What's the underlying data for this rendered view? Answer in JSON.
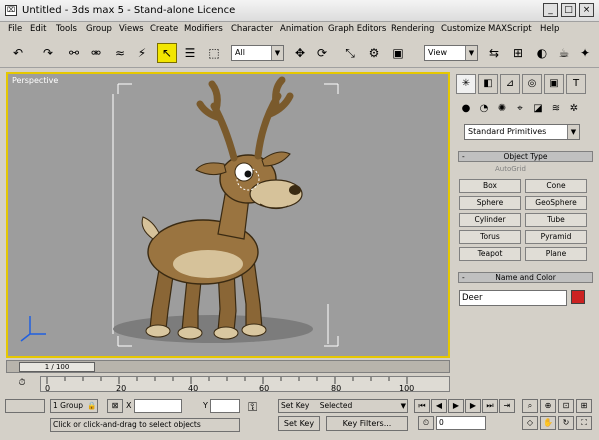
{
  "titlebar": {
    "app_icon": "3ds-max-icon",
    "title": "Untitled - 3ds max 5 - Stand-alone Licence"
  },
  "menu": [
    "File",
    "Edit",
    "Tools",
    "Group",
    "Views",
    "Create",
    "Modifiers",
    "Character",
    "Animation",
    "Graph Editors",
    "Rendering",
    "Customize",
    "MAXScript",
    "Help"
  ],
  "toolbar": {
    "selection_filter": "All",
    "ref_coord_system": "View"
  },
  "viewport": {
    "label": "Perspective"
  },
  "command_panel": {
    "category": "Standard Primitives",
    "object_type_title": "Object Type",
    "autogrid_label": "AutoGrid",
    "buttons": [
      "Box",
      "Cone",
      "Sphere",
      "GeoSphere",
      "Cylinder",
      "Tube",
      "Torus",
      "Pyramid",
      "Teapot",
      "Plane"
    ],
    "name_color_title": "Name and Color",
    "object_name": "Deer",
    "object_color": "#cc2222"
  },
  "timeline": {
    "slider_label": "1 / 100",
    "ruler_labels": [
      "0",
      "20",
      "40",
      "60",
      "80",
      "100"
    ]
  },
  "status": {
    "selection_count": "1 Group",
    "x_label": "X",
    "y_label": "Y",
    "set_key_filter": "Selected",
    "set_key_prefix": "Set Key",
    "set_key_button": "Set Key",
    "key_filters_button": "Key Filters...",
    "prompt": "Click or click-and-drag to select objects",
    "frame_value": "0"
  }
}
